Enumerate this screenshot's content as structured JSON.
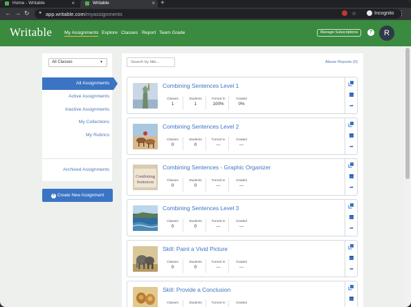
{
  "browser": {
    "tabs": [
      {
        "title": "Home - Writable"
      },
      {
        "title": "Writable"
      }
    ],
    "url_host": "app.writable.com",
    "url_path": "/myassignments",
    "incognito_label": "Incognito",
    "icons": {
      "back": "back-arrow-icon",
      "forward": "forward-arrow-icon",
      "reload": "reload-icon",
      "lock": "lock-icon",
      "star": "star-icon",
      "menu": "more-vert-icon"
    }
  },
  "header": {
    "logo": "Writable",
    "nav": {
      "my_assignments": "My Assignments",
      "explore": "Explore",
      "classes": "Classes",
      "report": "Report",
      "team_grade": "Team Grade"
    },
    "manage_subscriptions": "Manage Subscriptions",
    "help": "?",
    "avatar_initial": "R",
    "colors": {
      "brand": "#3a8a3f",
      "accent": "#3b74c4"
    }
  },
  "sidebar": {
    "class_filter": "All Classes",
    "items": {
      "all": "All Assignments",
      "active": "Active Assignments",
      "inactive": "Inactive Assignments",
      "collections": "My Collections",
      "rubrics": "My Rubrics",
      "archived": "Archived Assignments"
    },
    "create_button": "Create New Assignment"
  },
  "main": {
    "search_placeholder": "Search by title...",
    "abuse_reports": "Abuse Reports (0)",
    "stat_labels": {
      "classes": "Classes",
      "students": "Students",
      "turned_in": "Turned In",
      "graded": "Graded"
    },
    "assignments": [
      {
        "title": "Combining Sentences Level 1",
        "classes": "1",
        "students": "1",
        "turned_in": "100%",
        "graded": "0%",
        "thumb": "statue-of-liberty"
      },
      {
        "title": "Combining Sentences Level 2",
        "classes": "0",
        "students": "0",
        "turned_in": "---",
        "graded": "---",
        "thumb": "beach-camels"
      },
      {
        "title": "Combining Sentences - Graphic Organizer",
        "classes": "0",
        "students": "0",
        "turned_in": "---",
        "graded": "---",
        "thumb": "combining-sentences-book",
        "thumb_text": "Combining Sentences"
      },
      {
        "title": "Combining Sentences Level 3",
        "classes": "0",
        "students": "0",
        "turned_in": "---",
        "graded": "---",
        "thumb": "ocean-coast"
      },
      {
        "title": "Skill: Paint a Vivid Picture",
        "classes": "0",
        "students": "0",
        "turned_in": "---",
        "graded": "---",
        "thumb": "elephants"
      },
      {
        "title": "Skill: Provide a Conclusion",
        "classes": "",
        "students": "",
        "turned_in": "",
        "graded": "",
        "thumb": "lions"
      }
    ]
  }
}
